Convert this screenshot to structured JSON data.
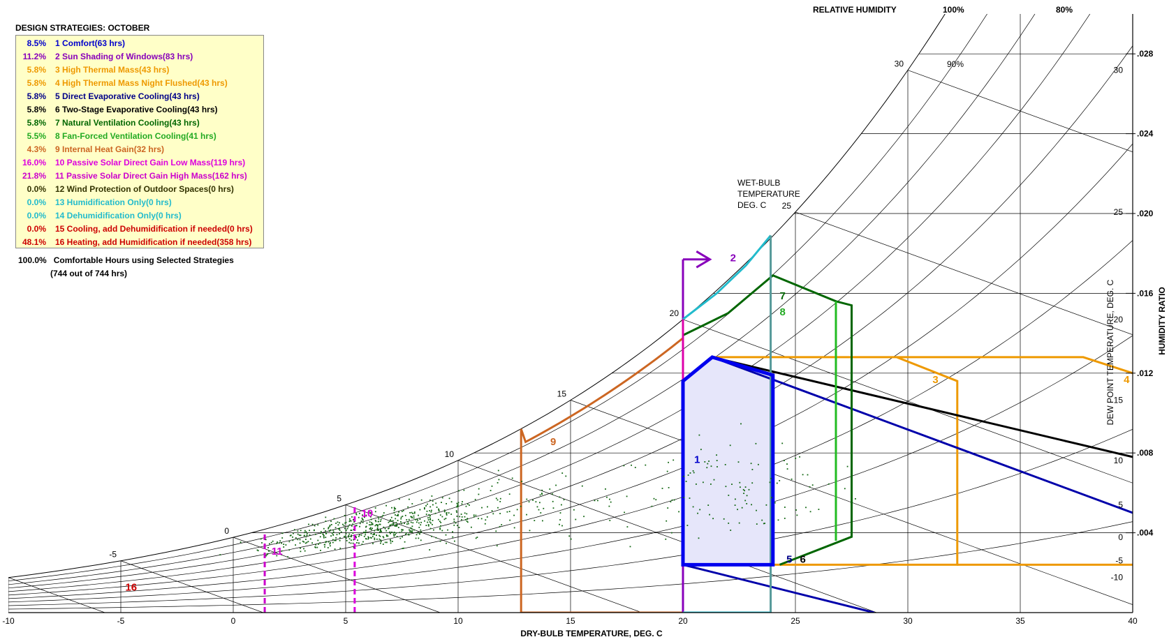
{
  "chart_data": {
    "type": "scatter",
    "title": "DESIGN STRATEGIES:  OCTOBER",
    "xlabel": "DRY-BULB TEMPERATURE, DEG. C",
    "ylabel": "HUMIDITY RATIO",
    "y2label": "DEW POINT TEMPERATURE, DEG. C",
    "wetbulb_label": [
      "WET-BULB",
      "TEMPERATURE",
      "DEG. C"
    ],
    "rh_label": "RELATIVE HUMIDITY",
    "rh_tick_labels": [
      "100%",
      "90%",
      "80%"
    ],
    "xlim": [
      -10,
      40
    ],
    "ylim": [
      0,
      0.03
    ],
    "xticks": [
      -10,
      -5,
      0,
      5,
      10,
      15,
      20,
      25,
      30,
      35,
      40
    ],
    "yticks": [
      ".004",
      ".008",
      ".012",
      ".016",
      ".020",
      ".024",
      ".028"
    ],
    "yticks_values": [
      0.004,
      0.008,
      0.012,
      0.016,
      0.02,
      0.024,
      0.028
    ],
    "dewpoint_ticks": [
      -10,
      -5,
      0,
      5,
      10,
      15,
      20,
      25,
      30
    ],
    "wetbulb_ticks": [
      -5,
      0,
      5,
      10,
      15,
      20,
      25,
      30
    ],
    "grid": true,
    "legend": [
      {
        "pct": "8.5%",
        "label": "1  Comfort(63 hrs)",
        "color": "#0000cc"
      },
      {
        "pct": "11.2%",
        "label": "2  Sun Shading of Windows(83 hrs)",
        "color": "#8800bb"
      },
      {
        "pct": "5.8%",
        "label": "3  High Thermal Mass(43 hrs)",
        "color": "#ee9900"
      },
      {
        "pct": "5.8%",
        "label": "4  High Thermal Mass Night Flushed(43 hrs)",
        "color": "#ee9900"
      },
      {
        "pct": "5.8%",
        "label": "5  Direct Evaporative Cooling(43 hrs)",
        "color": "#000088"
      },
      {
        "pct": "5.8%",
        "label": "6  Two-Stage Evaporative Cooling(43 hrs)",
        "color": "#000000"
      },
      {
        "pct": "5.8%",
        "label": "7  Natural Ventilation Cooling(43 hrs)",
        "color": "#006600"
      },
      {
        "pct": "5.5%",
        "label": "8  Fan-Forced Ventilation Cooling(41 hrs)",
        "color": "#22aa22"
      },
      {
        "pct": "4.3%",
        "label": "9  Internal Heat Gain(32 hrs)",
        "color": "#cc6622"
      },
      {
        "pct": "16.0%",
        "label": "10  Passive Solar Direct Gain Low Mass(119 hrs)",
        "color": "#dd00dd"
      },
      {
        "pct": "21.8%",
        "label": "11  Passive Solar Direct Gain High Mass(162 hrs)",
        "color": "#cc00cc"
      },
      {
        "pct": "0.0%",
        "label": "12  Wind Protection of Outdoor Spaces(0 hrs)",
        "color": "#333300"
      },
      {
        "pct": "0.0%",
        "label": "13  Humidification Only(0 hrs)",
        "color": "#22bbcc"
      },
      {
        "pct": "0.0%",
        "label": "14  Dehumidification Only(0 hrs)",
        "color": "#22bbcc"
      },
      {
        "pct": "0.0%",
        "label": "15  Cooling, add Dehumidification if needed(0 hrs)",
        "color": "#cc0000"
      },
      {
        "pct": "48.1%",
        "label": "16  Heating, add Humidification if needed(358 hrs)",
        "color": "#cc0000"
      }
    ],
    "summary_pct": "100.0%",
    "summary_text": "Comfortable Hours using Selected Strategies",
    "summary_sub": "(744 out of 744 hrs)",
    "zone_labels": [
      {
        "text": "1",
        "x": 20.5,
        "y": 0.0075,
        "color": "#0000cc"
      },
      {
        "text": "2",
        "x": 22.1,
        "y": 0.0176,
        "color": "#8800bb"
      },
      {
        "text": "3",
        "x": 31.1,
        "y": 0.0115,
        "color": "#ee9900"
      },
      {
        "text": "4",
        "x": 39.6,
        "y": 0.0115,
        "color": "#ee9900"
      },
      {
        "text": "5",
        "x": 24.6,
        "y": 0.0025,
        "color": "#000088"
      },
      {
        "text": "6",
        "x": 25.2,
        "y": 0.0025,
        "color": "#000000"
      },
      {
        "text": "7",
        "x": 24.3,
        "y": 0.0157,
        "color": "#006600"
      },
      {
        "text": "8",
        "x": 24.3,
        "y": 0.0149,
        "color": "#22aa22"
      },
      {
        "text": "9",
        "x": 14.1,
        "y": 0.0084,
        "color": "#cc6622"
      },
      {
        "text": "10",
        "x": 5.7,
        "y": 0.0048,
        "color": "#dd00dd"
      },
      {
        "text": "11",
        "x": 1.7,
        "y": 0.0029,
        "color": "#cc00cc"
      },
      {
        "text": "16",
        "x": -4.8,
        "y": 0.0011,
        "color": "#cc0000"
      }
    ],
    "points_summary": "744 hourly data points distributed between about -9 C and 28 C dry-bulb, concentrated between 2 C and 10 C"
  }
}
